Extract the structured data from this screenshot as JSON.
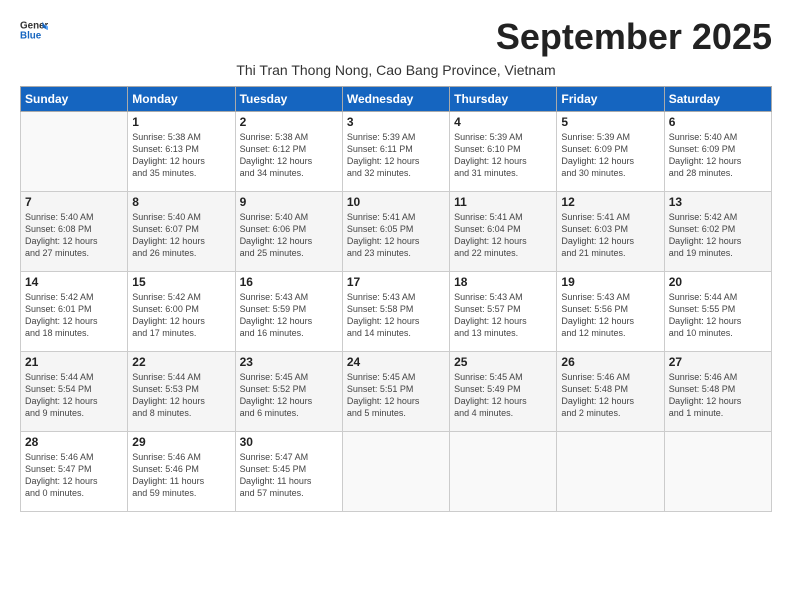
{
  "header": {
    "logo_general": "General",
    "logo_blue": "Blue",
    "title": "September 2025",
    "subtitle": "Thi Tran Thong Nong, Cao Bang Province, Vietnam"
  },
  "days_of_week": [
    "Sunday",
    "Monday",
    "Tuesday",
    "Wednesday",
    "Thursday",
    "Friday",
    "Saturday"
  ],
  "weeks": [
    [
      {
        "day": "",
        "info": ""
      },
      {
        "day": "1",
        "info": "Sunrise: 5:38 AM\nSunset: 6:13 PM\nDaylight: 12 hours\nand 35 minutes."
      },
      {
        "day": "2",
        "info": "Sunrise: 5:38 AM\nSunset: 6:12 PM\nDaylight: 12 hours\nand 34 minutes."
      },
      {
        "day": "3",
        "info": "Sunrise: 5:39 AM\nSunset: 6:11 PM\nDaylight: 12 hours\nand 32 minutes."
      },
      {
        "day": "4",
        "info": "Sunrise: 5:39 AM\nSunset: 6:10 PM\nDaylight: 12 hours\nand 31 minutes."
      },
      {
        "day": "5",
        "info": "Sunrise: 5:39 AM\nSunset: 6:09 PM\nDaylight: 12 hours\nand 30 minutes."
      },
      {
        "day": "6",
        "info": "Sunrise: 5:40 AM\nSunset: 6:09 PM\nDaylight: 12 hours\nand 28 minutes."
      }
    ],
    [
      {
        "day": "7",
        "info": "Sunrise: 5:40 AM\nSunset: 6:08 PM\nDaylight: 12 hours\nand 27 minutes."
      },
      {
        "day": "8",
        "info": "Sunrise: 5:40 AM\nSunset: 6:07 PM\nDaylight: 12 hours\nand 26 minutes."
      },
      {
        "day": "9",
        "info": "Sunrise: 5:40 AM\nSunset: 6:06 PM\nDaylight: 12 hours\nand 25 minutes."
      },
      {
        "day": "10",
        "info": "Sunrise: 5:41 AM\nSunset: 6:05 PM\nDaylight: 12 hours\nand 23 minutes."
      },
      {
        "day": "11",
        "info": "Sunrise: 5:41 AM\nSunset: 6:04 PM\nDaylight: 12 hours\nand 22 minutes."
      },
      {
        "day": "12",
        "info": "Sunrise: 5:41 AM\nSunset: 6:03 PM\nDaylight: 12 hours\nand 21 minutes."
      },
      {
        "day": "13",
        "info": "Sunrise: 5:42 AM\nSunset: 6:02 PM\nDaylight: 12 hours\nand 19 minutes."
      }
    ],
    [
      {
        "day": "14",
        "info": "Sunrise: 5:42 AM\nSunset: 6:01 PM\nDaylight: 12 hours\nand 18 minutes."
      },
      {
        "day": "15",
        "info": "Sunrise: 5:42 AM\nSunset: 6:00 PM\nDaylight: 12 hours\nand 17 minutes."
      },
      {
        "day": "16",
        "info": "Sunrise: 5:43 AM\nSunset: 5:59 PM\nDaylight: 12 hours\nand 16 minutes."
      },
      {
        "day": "17",
        "info": "Sunrise: 5:43 AM\nSunset: 5:58 PM\nDaylight: 12 hours\nand 14 minutes."
      },
      {
        "day": "18",
        "info": "Sunrise: 5:43 AM\nSunset: 5:57 PM\nDaylight: 12 hours\nand 13 minutes."
      },
      {
        "day": "19",
        "info": "Sunrise: 5:43 AM\nSunset: 5:56 PM\nDaylight: 12 hours\nand 12 minutes."
      },
      {
        "day": "20",
        "info": "Sunrise: 5:44 AM\nSunset: 5:55 PM\nDaylight: 12 hours\nand 10 minutes."
      }
    ],
    [
      {
        "day": "21",
        "info": "Sunrise: 5:44 AM\nSunset: 5:54 PM\nDaylight: 12 hours\nand 9 minutes."
      },
      {
        "day": "22",
        "info": "Sunrise: 5:44 AM\nSunset: 5:53 PM\nDaylight: 12 hours\nand 8 minutes."
      },
      {
        "day": "23",
        "info": "Sunrise: 5:45 AM\nSunset: 5:52 PM\nDaylight: 12 hours\nand 6 minutes."
      },
      {
        "day": "24",
        "info": "Sunrise: 5:45 AM\nSunset: 5:51 PM\nDaylight: 12 hours\nand 5 minutes."
      },
      {
        "day": "25",
        "info": "Sunrise: 5:45 AM\nSunset: 5:49 PM\nDaylight: 12 hours\nand 4 minutes."
      },
      {
        "day": "26",
        "info": "Sunrise: 5:46 AM\nSunset: 5:48 PM\nDaylight: 12 hours\nand 2 minutes."
      },
      {
        "day": "27",
        "info": "Sunrise: 5:46 AM\nSunset: 5:48 PM\nDaylight: 12 hours\nand 1 minute."
      }
    ],
    [
      {
        "day": "28",
        "info": "Sunrise: 5:46 AM\nSunset: 5:47 PM\nDaylight: 12 hours\nand 0 minutes."
      },
      {
        "day": "29",
        "info": "Sunrise: 5:46 AM\nSunset: 5:46 PM\nDaylight: 11 hours\nand 59 minutes."
      },
      {
        "day": "30",
        "info": "Sunrise: 5:47 AM\nSunset: 5:45 PM\nDaylight: 11 hours\nand 57 minutes."
      },
      {
        "day": "",
        "info": ""
      },
      {
        "day": "",
        "info": ""
      },
      {
        "day": "",
        "info": ""
      },
      {
        "day": "",
        "info": ""
      }
    ]
  ]
}
